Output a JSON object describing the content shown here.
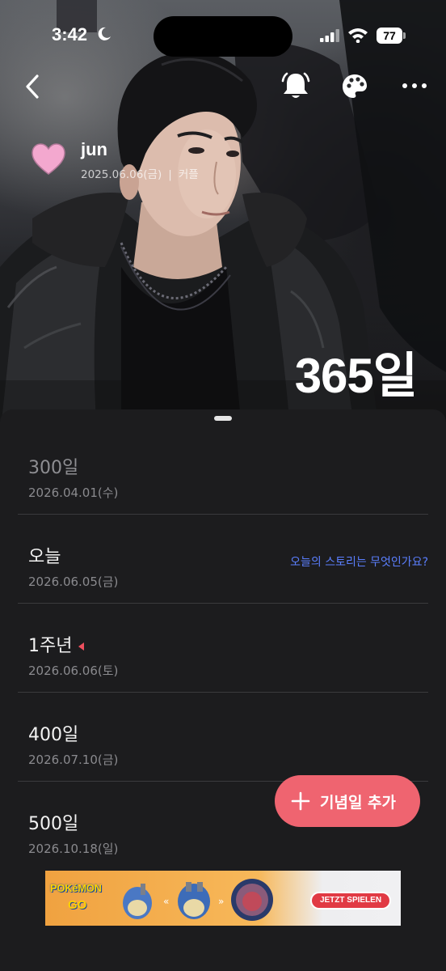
{
  "status_bar": {
    "time": "3:42",
    "battery": "77"
  },
  "header": {
    "couple_name": "jun",
    "start_date": "2025.06.06(금)",
    "separator": "|",
    "category": "커플",
    "day_count": "365일"
  },
  "anniversaries": [
    {
      "title": "300일",
      "date": "2026.04.01(수)"
    },
    {
      "title": "오늘",
      "date": "2026.06.05(금)",
      "link": "오늘의 스토리는 무엇인가요?"
    },
    {
      "title": "1주년",
      "date": "2026.06.06(토)"
    },
    {
      "title": "400일",
      "date": "2026.07.10(금)"
    },
    {
      "title": "500일",
      "date": "2026.10.18(일)"
    }
  ],
  "fab": {
    "label": "기념일 추가"
  },
  "ad": {
    "logo": "POKéMON",
    "logo_sub": "GO",
    "cta": "JETZT SPIELEN"
  },
  "colors": {
    "accent": "#ef6470",
    "link": "#5b7fff",
    "heart": "#f3a8cf",
    "sheet_bg": "#1c1c1e",
    "marker": "#ee4f5e"
  },
  "icons": [
    "moon-icon",
    "signal-icon",
    "wifi-icon",
    "back-arrow-icon",
    "bell-icon",
    "palette-icon",
    "more-icon",
    "heart-icon",
    "plus-icon"
  ]
}
